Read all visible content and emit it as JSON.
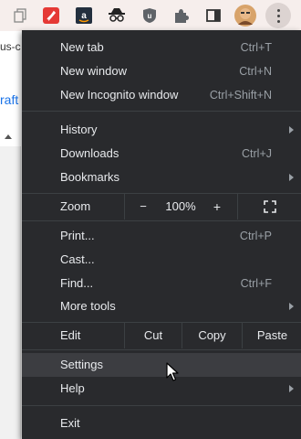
{
  "background_page": {
    "url_fragment": "us-c",
    "link_fragment": "raft"
  },
  "toolbar": {
    "icons": [
      "copy-icon",
      "rocket-extension-icon",
      "amazon-extension-icon",
      "incognito-extension-icon",
      "ublock-extension-icon",
      "puzzle-extensions-icon",
      "sidebar-icon",
      "profile-avatar",
      "three-dot-menu-icon"
    ]
  },
  "menu": {
    "new_tab": {
      "label": "New tab",
      "shortcut": "Ctrl+T"
    },
    "new_window": {
      "label": "New window",
      "shortcut": "Ctrl+N"
    },
    "new_incognito": {
      "label": "New Incognito window",
      "shortcut": "Ctrl+Shift+N"
    },
    "history": {
      "label": "History"
    },
    "downloads": {
      "label": "Downloads",
      "shortcut": "Ctrl+J"
    },
    "bookmarks": {
      "label": "Bookmarks"
    },
    "zoom": {
      "label": "Zoom",
      "minus": "−",
      "value": "100%",
      "plus": "+"
    },
    "print": {
      "label": "Print...",
      "shortcut": "Ctrl+P"
    },
    "cast": {
      "label": "Cast..."
    },
    "find": {
      "label": "Find...",
      "shortcut": "Ctrl+F"
    },
    "more_tools": {
      "label": "More tools"
    },
    "edit": {
      "label": "Edit",
      "cut": "Cut",
      "copy": "Copy",
      "paste": "Paste"
    },
    "settings": {
      "label": "Settings"
    },
    "help": {
      "label": "Help"
    },
    "exit": {
      "label": "Exit"
    }
  },
  "colors": {
    "menu_bg": "#292a2d",
    "menu_text": "#e8eaed",
    "shortcut_text": "#9aa0a6",
    "hover_bg": "#3c3d41",
    "toolbar_bg": "#f6eeec"
  }
}
